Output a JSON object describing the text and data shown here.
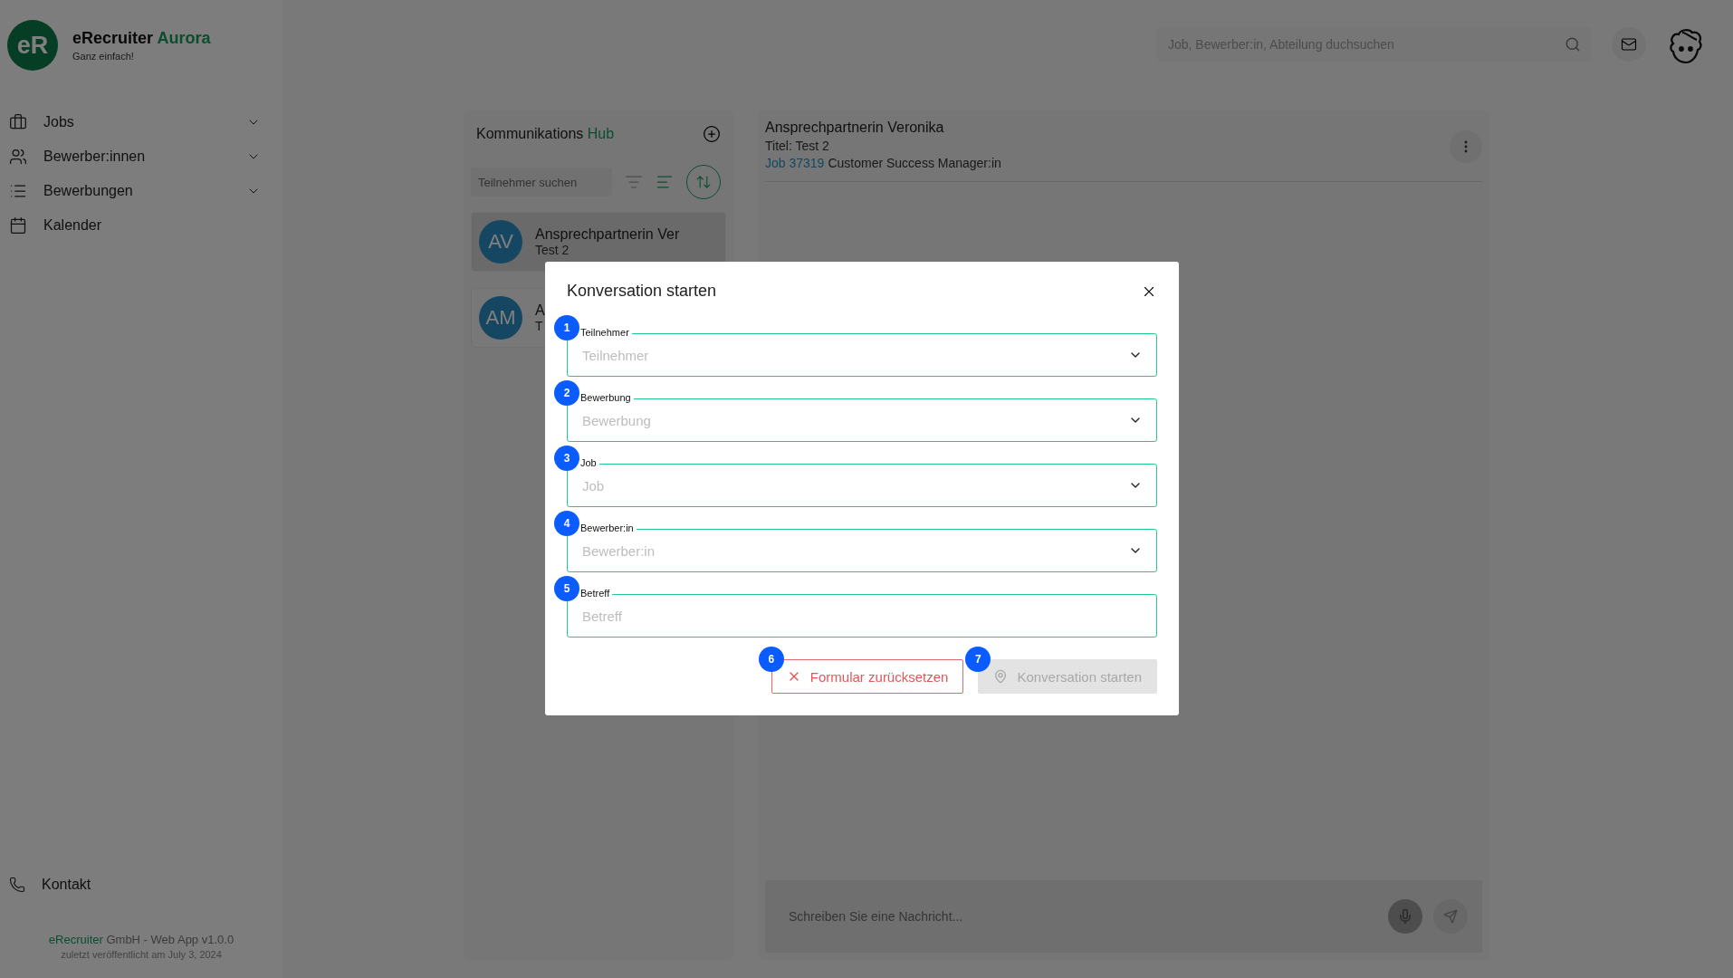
{
  "app": {
    "logo": "eR",
    "name": "eRecruiter",
    "name_accent": "Aurora",
    "tagline": "Ganz einfach!"
  },
  "sidebar": {
    "items": [
      {
        "label": "Jobs",
        "expandable": true
      },
      {
        "label": "Bewerber:innen",
        "expandable": true
      },
      {
        "label": "Bewerbungen",
        "expandable": true
      },
      {
        "label": "Kalender",
        "expandable": false
      }
    ],
    "contact": "Kontakt",
    "footer": {
      "company_accent": "eRecruiter",
      "company": "GmbH - Web App v1.0.0",
      "released": "zuletzt veröffentlicht am July 3, 2024"
    }
  },
  "topbar": {
    "search_placeholder": "Job, Bewerber:in, Abteilung duchsuchen"
  },
  "hub": {
    "title": "Kommunikations",
    "title_accent": "Hub",
    "search_placeholder": "Teilnehmer suchen",
    "conversations": [
      {
        "initials": "AV",
        "name": "Ansprechpartnerin Ver",
        "subtitle": "Test 2",
        "selected": true
      },
      {
        "initials": "AM",
        "name": "A",
        "subtitle": "T",
        "selected": false
      }
    ]
  },
  "chat": {
    "name": "Ansprechpartnerin Veronika",
    "title": "Titel: Test 2",
    "job_link": "Job 37319",
    "job_title": "Customer Success Manager:in",
    "input_placeholder": "Schreiben Sie eine Nachricht..."
  },
  "modal": {
    "title": "Konversation starten",
    "fields": [
      {
        "step": "1",
        "label": "Teilnehmer",
        "placeholder": "Teilnehmer",
        "kind": "select"
      },
      {
        "step": "2",
        "label": "Bewerbung",
        "placeholder": "Bewerbung",
        "kind": "select"
      },
      {
        "step": "3",
        "label": "Job",
        "placeholder": "Job",
        "kind": "select"
      },
      {
        "step": "4",
        "label": "Bewerber:in",
        "placeholder": "Bewerber:in",
        "kind": "select"
      },
      {
        "step": "5",
        "label": "Betreff",
        "placeholder": "Betreff",
        "kind": "text"
      }
    ],
    "actions": [
      {
        "step": "6",
        "label": "Formular zurücksetzen",
        "kind": "reset",
        "disabled": false
      },
      {
        "step": "7",
        "label": "Konversation starten",
        "kind": "submit",
        "disabled": true
      }
    ]
  }
}
